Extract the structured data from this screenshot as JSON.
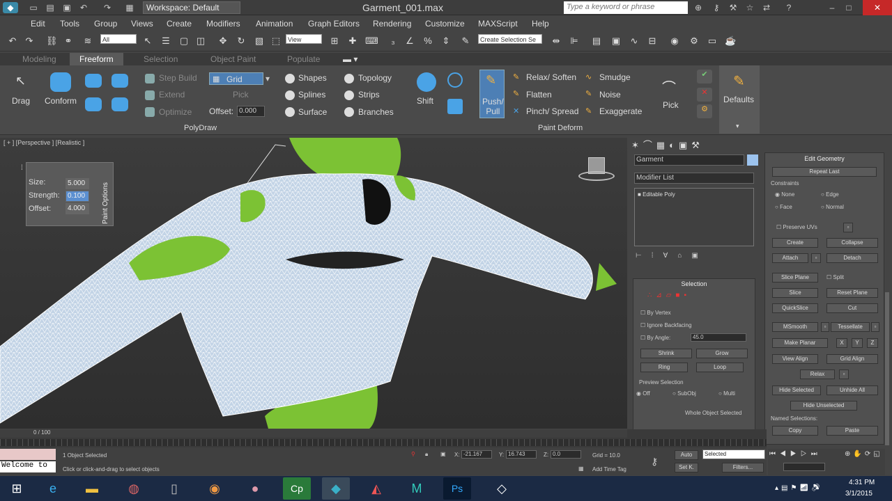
{
  "window": {
    "workspace": "Workspace: Default",
    "title": "Garment_001.max",
    "search_placeholder": "Type a keyword or phrase"
  },
  "menu": [
    "Edit",
    "Tools",
    "Group",
    "Views",
    "Create",
    "Modifiers",
    "Animation",
    "Graph Editors",
    "Rendering",
    "Customize",
    "MAXScript",
    "Help"
  ],
  "toolbar": {
    "filter": "All",
    "view": "View",
    "selection_set": "Create Selection Se"
  },
  "ribbon_tabs": [
    "Modeling",
    "Freeform",
    "Selection",
    "Object Paint",
    "Populate"
  ],
  "ribbon": {
    "drag": "Drag",
    "conform": "Conform",
    "step_build": "Step Build",
    "extend": "Extend",
    "optimize": "Optimize",
    "grid": "Grid",
    "pick": "Pick",
    "offset_label": "Offset:",
    "offset_value": "0.000",
    "shapes": "Shapes",
    "splines": "Splines",
    "surface": "Surface",
    "topology": "Topology",
    "strips": "Strips",
    "branches": "Branches",
    "polydraw": "PolyDraw",
    "shift": "Shift",
    "push_pull": "Push/\nPull",
    "relax_soften": "Relax/ Soften",
    "flatten": "Flatten",
    "pinch_spread": "Pinch/ Spread",
    "smudge": "Smudge",
    "noise": "Noise",
    "exaggerate": "Exaggerate",
    "paint_deform": "Paint Deform",
    "pick2": "Pick",
    "defaults": "Defaults"
  },
  "viewport": {
    "label": "[ + ] [Perspective ] [Realistic ]"
  },
  "paint_options": {
    "title": "Paint Options",
    "size_label": "Size:",
    "size": "5.000",
    "strength_label": "Strength:",
    "strength": "0.100",
    "offset_label": "Offset:",
    "offset": "4.000"
  },
  "command": {
    "object_name": "Garment",
    "modifier_list": "Modifier List",
    "stack_item": "Editable Poly",
    "selection_title": "Selection",
    "by_vertex": "By Vertex",
    "ignore_backfacing": "Ignore Backfacing",
    "by_angle": "By Angle:",
    "angle": "45.0",
    "shrink": "Shrink",
    "grow": "Grow",
    "ring": "Ring",
    "loop": "Loop",
    "preview": "Preview Selection",
    "off": "Off",
    "subobj": "SubObj",
    "multi": "Multi",
    "whole": "Whole Object Selected"
  },
  "edit_geometry": {
    "title": "Edit Geometry",
    "repeat": "Repeat Last",
    "constraints": "Constraints",
    "none": "None",
    "edge": "Edge",
    "face": "Face",
    "normal": "Normal",
    "preserve": "Preserve UVs",
    "create": "Create",
    "collapse": "Collapse",
    "attach": "Attach",
    "detach": "Detach",
    "slice_plane": "Slice Plane",
    "split": "Split",
    "slice": "Slice",
    "reset_plane": "Reset Plane",
    "quickslice": "QuickSlice",
    "cut": "Cut",
    "msmooth": "MSmooth",
    "tessellate": "Tessellate",
    "make_planar": "Make Planar",
    "x": "X",
    "y": "Y",
    "z": "Z",
    "view_align": "View Align",
    "grid_align": "Grid Align",
    "relax": "Relax",
    "hide_sel": "Hide Selected",
    "unhide_all": "Unhide All",
    "hide_unsel": "Hide Unselected",
    "named": "Named Selections:",
    "copy": "Copy",
    "paste": "Paste"
  },
  "timeline": {
    "frame": "0 / 100"
  },
  "status": {
    "welcome": "Welcome to",
    "selected": "1 Object Selected",
    "hint": "Click or click-and-drag to select objects",
    "x": "-21.167",
    "y": "16.743",
    "z": "0.0",
    "grid": "Grid = 10.0",
    "add_time_tag": "Add Time Tag",
    "auto": "Auto",
    "set_k": "Set K.",
    "key_mode": "Selected",
    "filters": "Filters..."
  },
  "clock": {
    "time": "4:31 PM",
    "date": "3/1/2015"
  }
}
